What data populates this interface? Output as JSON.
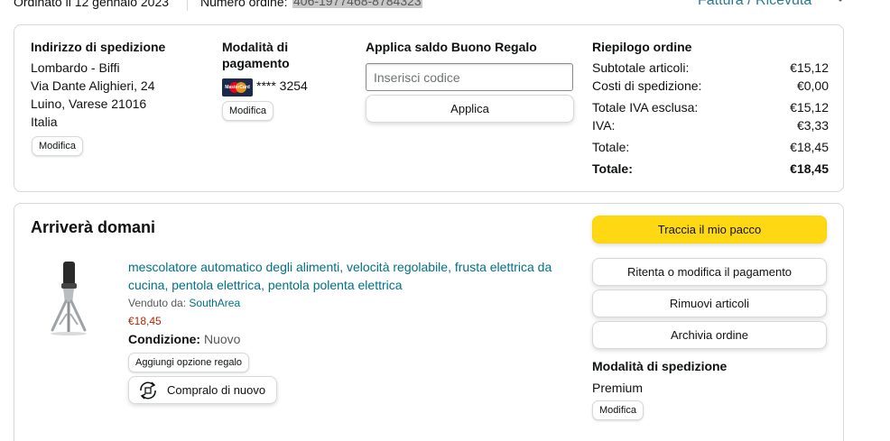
{
  "topbar": {
    "ordered": "Ordinato il 12 gennaio 2023",
    "order_number_label": "Numero ordine:",
    "order_number": "406-1977468-8784323",
    "invoice_link": "Fattura / Ricevuta"
  },
  "summary_card": {
    "shipping": {
      "title": "Indirizzo di spedizione",
      "lines": [
        "Lombardo - Biffi",
        "Via Dante Alighieri, 24",
        "Luino, Varese 21016",
        "Italia"
      ],
      "edit_label": "Modifica"
    },
    "payment": {
      "title_line1": "Modalità di",
      "title_line2": "pagamento",
      "card_brand": "MasterCard",
      "card_masked": "**** 3254",
      "edit_label": "Modifica"
    },
    "gift": {
      "title": "Applica saldo Buono Regalo",
      "placeholder": "Inserisci codice",
      "apply_label": "Applica"
    },
    "order_summary": {
      "title": "Riepilogo ordine",
      "rows": [
        {
          "label": "Subtotale articoli:",
          "value": "€15,12"
        },
        {
          "label": "Costi di spedizione:",
          "value": "€0,00"
        },
        {
          "label": "Totale IVA esclusa:",
          "value": "€15,12"
        },
        {
          "label": "IVA:",
          "value": "€3,33"
        },
        {
          "label": "Totale:",
          "value": "€18,45"
        }
      ],
      "grand_total_label": "Totale:",
      "grand_total_value": "€18,45"
    }
  },
  "shipment_card": {
    "heading": "Arriverà domani",
    "product": {
      "title": "mescolatore automatico degli alimenti, velocità regolabile, frusta elettrica da cucina, pentola elettrica, pentola polenta elettrica",
      "sold_by_label": "Venduto da:",
      "seller": "SouthArea",
      "price": "€18,45",
      "condition_label": "Condizione:",
      "condition_value": "Nuovo",
      "gift_option_label": "Aggiungi opzione regalo",
      "buy_again_label": "Compralo di nuovo"
    },
    "actions": {
      "track": "Traccia il mio pacco",
      "retry_payment": "Ritenta o modifica il pagamento",
      "remove_items": "Rimuovi articoli",
      "archive_order": "Archivia ordine"
    },
    "shipping_mode": {
      "title": "Modalità di spedizione",
      "value": "Premium",
      "edit_label": "Modifica"
    }
  },
  "colors": {
    "link": "#007185",
    "price": "#b12704",
    "primary_button": "#ffd814",
    "border": "#d5d9d9"
  }
}
